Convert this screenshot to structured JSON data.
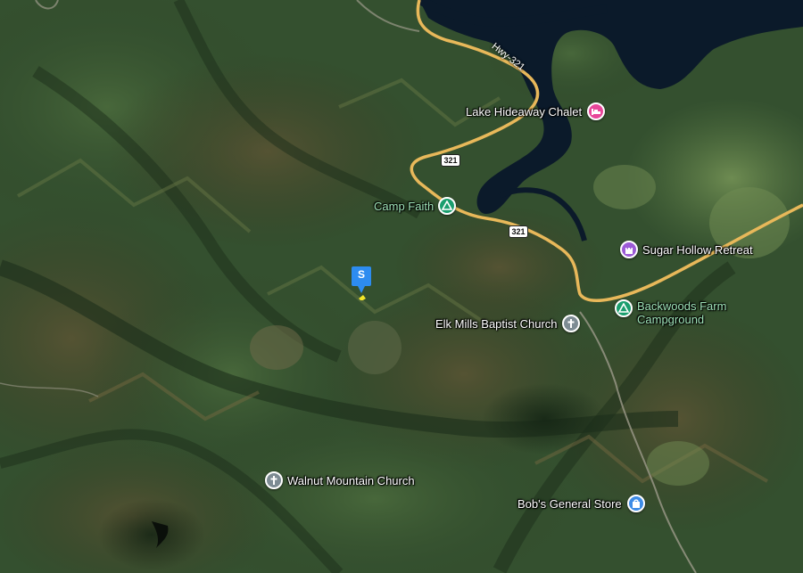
{
  "map": {
    "type": "satellite",
    "colors": {
      "water": "#0b1a2a",
      "road": "#e8b85a",
      "lodging": "#e8479a",
      "campground": "#1a9e6e",
      "worship": "#7d8b93",
      "attraction": "#9c5bd6",
      "shopping": "#3e8ce6",
      "selected_marker": "#2d8cf0"
    }
  },
  "places": [
    {
      "id": "lake-hideaway-chalet",
      "name": "Lake Hideaway Chalet",
      "category": "lodging",
      "icon": "bed-icon",
      "label_color": "#ffffff"
    },
    {
      "id": "camp-faith",
      "name": "Camp Faith",
      "category": "campground",
      "icon": "tent-icon",
      "label_color": "#9fe3b8"
    },
    {
      "id": "sugar-hollow-retreat",
      "name": "Sugar Hollow Retreat",
      "category": "attraction",
      "icon": "castle-icon",
      "label_color": "#ffffff"
    },
    {
      "id": "backwoods-farm-campground",
      "name": "Backwoods Farm Campground",
      "name_line1": "Backwoods Farm",
      "name_line2": "Campground",
      "category": "campground",
      "icon": "tent-icon",
      "label_color": "#9fe3b8"
    },
    {
      "id": "elk-mills-baptist-church",
      "name": "Elk Mills Baptist Church",
      "category": "worship",
      "icon": "cross-icon",
      "label_color": "#ffffff"
    },
    {
      "id": "walnut-mountain-church",
      "name": "Walnut Mountain Church",
      "category": "worship",
      "icon": "cross-icon",
      "label_color": "#ffffff"
    },
    {
      "id": "bobs-general-store",
      "name": "Bob's General Store",
      "category": "shopping",
      "icon": "shopping-bag-icon",
      "label_color": "#ffffff"
    }
  ],
  "roads": {
    "route_label": "Hwy-321",
    "shield_number": "321"
  },
  "selected_marker": {
    "letter": "S",
    "icon": "location-pin-icon"
  }
}
